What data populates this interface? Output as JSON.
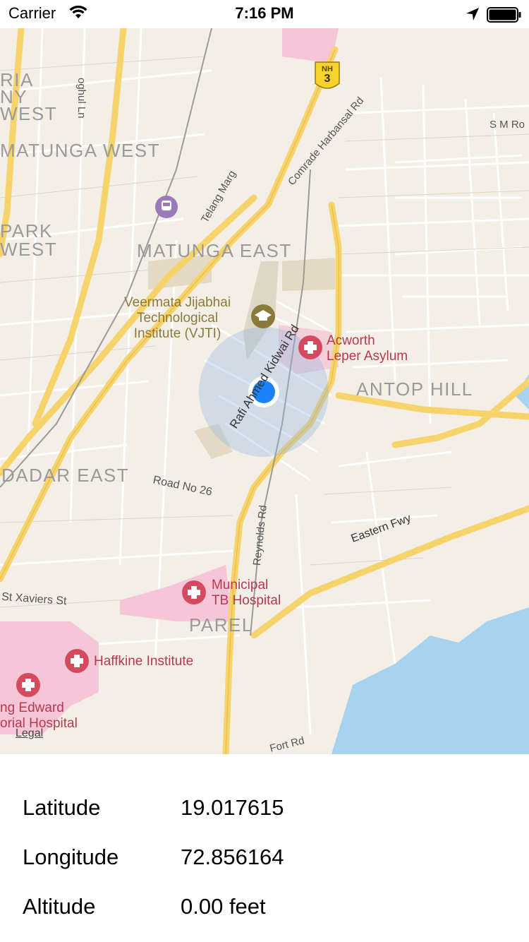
{
  "status_bar": {
    "carrier": "Carrier",
    "time": "7:16 PM",
    "wifi_icon": "wifi-icon",
    "location_icon": "location-arrow-icon",
    "battery_icon": "battery-icon"
  },
  "map": {
    "districts": [
      "MATUNGA EAST",
      "ANTOP HILL",
      "DADAR EAST",
      "PAREL",
      "MATUNGA WEST",
      "PARK",
      "WEST",
      "RIA",
      "NY",
      "WEST"
    ],
    "pois": {
      "vjti": "Veermata Jijabhai\nTechnological\nInstitute (VJTI)",
      "acworth": "Acworth\nLeper Asylum",
      "tb_hospital": "Municipal\nTB Hospital",
      "haffkine": "Haffkine Institute",
      "kem": "ng Edward\norial Hospital"
    },
    "roads": {
      "rafi": "Rafi Ahmed Kidwai Rd",
      "eastern": "Eastern Fwy",
      "road26": "Road No 26",
      "xaviers": "St Xaviers St",
      "reynolds": "Reynolds Rd",
      "telang": "Telang Marg",
      "harbansal": "Comrade Harbansal Rd",
      "smro": "S M Ro",
      "fort": "Fort Rd",
      "lane": "oghul Ln"
    },
    "shield": {
      "top": "NH",
      "number": "3"
    },
    "legal": "Legal",
    "colors": {
      "land": "#f4efe6",
      "water": "#a6d3ee",
      "hospital": "#f6c6d8",
      "major_road": "#f7d36b",
      "user_dot": "#1a82fb"
    }
  },
  "location": {
    "latitude_label": "Latitude",
    "latitude_value": "19.017615",
    "longitude_label": "Longitude",
    "longitude_value": "72.856164",
    "altitude_label": "Altitude",
    "altitude_value": "0.00 feet"
  }
}
